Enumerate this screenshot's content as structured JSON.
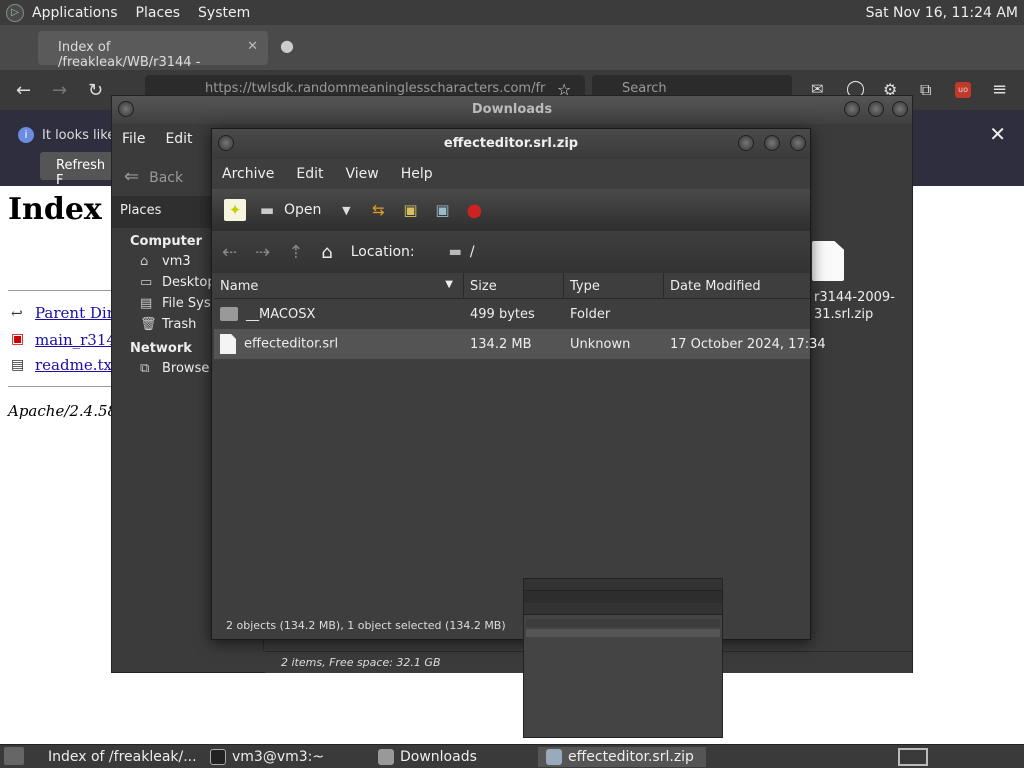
{
  "top_panel": {
    "menus": [
      "Applications",
      "Places",
      "System"
    ],
    "clock": "Sat Nov 16, 11:24 AM"
  },
  "firefox": {
    "tab_title": "Index of /freakleak/WB/r3144 -",
    "url": "https://twlsdk.randommeaninglesscharacters.com/fr",
    "search_placeholder": "Search",
    "notification_text": "It looks like",
    "refresh_label": "Refresh F",
    "page": {
      "heading": "Index o",
      "links": [
        "Parent Direc",
        "main_r3144",
        "readme.txt"
      ],
      "footer": "Apache/2.4.58 ("
    }
  },
  "downloads": {
    "title": "Downloads",
    "menus": [
      "File",
      "Edit",
      "V"
    ],
    "back_label": "Back",
    "places_label": "Places",
    "sidebar": {
      "computer_label": "Computer",
      "computer_items": [
        "vm3",
        "Desktop",
        "File Syst",
        "Trash"
      ],
      "network_label": "Network",
      "network_items": [
        "Browse N"
      ]
    },
    "zip_name_line1": "r3144-2009-",
    "zip_name_line2": "31.srl.zip",
    "status": "2 items, Free space: 32.1 GB"
  },
  "archive": {
    "title": "effecteditor.srl.zip",
    "menus": [
      "Archive",
      "Edit",
      "View",
      "Help"
    ],
    "open_label": "Open",
    "location_label": "Location:",
    "location_value": "/",
    "columns": [
      "Name",
      "Size",
      "Type",
      "Date Modified"
    ],
    "rows": [
      {
        "name": "__MACOSX",
        "size": "499 bytes",
        "type": "Folder",
        "date": ""
      },
      {
        "name": "effecteditor.srl",
        "size": "134.2 MB",
        "type": "Unknown",
        "date": "17 October 2024, 17:34"
      }
    ],
    "status": "2 objects (134.2 MB), 1 object selected (134.2 MB)"
  },
  "taskbar": {
    "items": [
      "Index of /freakleak/...",
      "vm3@vm3:~",
      "Downloads",
      "effecteditor.srl.zip"
    ]
  }
}
